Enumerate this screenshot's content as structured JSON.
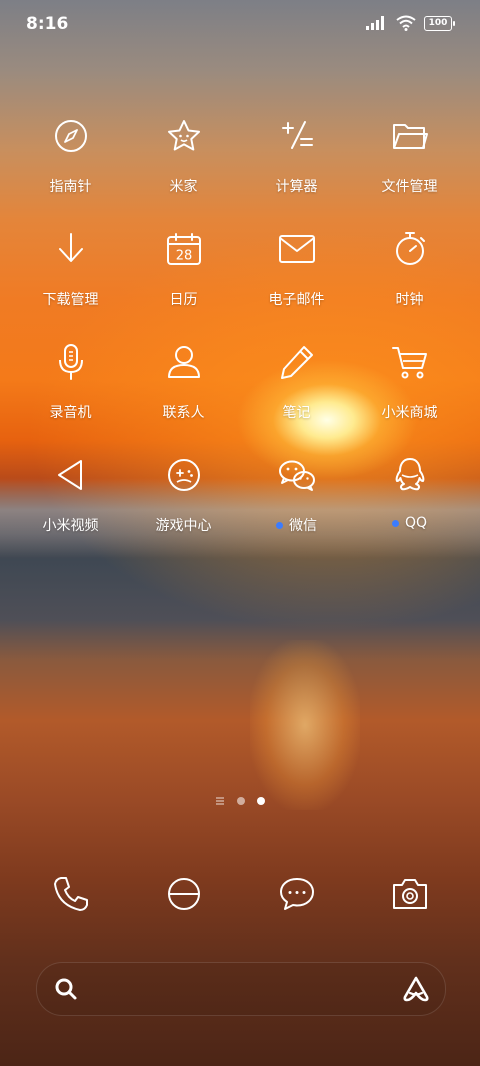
{
  "status": {
    "time": "8:16",
    "battery": "100"
  },
  "apps": [
    {
      "label": "指南针",
      "icon": "compass-icon"
    },
    {
      "label": "米家",
      "icon": "star-icon"
    },
    {
      "label": "计算器",
      "icon": "calculator-icon"
    },
    {
      "label": "文件管理",
      "icon": "folder-icon"
    },
    {
      "label": "下载管理",
      "icon": "download-icon"
    },
    {
      "label": "日历",
      "icon": "calendar-icon",
      "date": "28"
    },
    {
      "label": "电子邮件",
      "icon": "mail-icon"
    },
    {
      "label": "时钟",
      "icon": "clock-icon"
    },
    {
      "label": "录音机",
      "icon": "microphone-icon"
    },
    {
      "label": "联系人",
      "icon": "contact-icon"
    },
    {
      "label": "笔记",
      "icon": "pencil-icon"
    },
    {
      "label": "小米商城",
      "icon": "cart-icon"
    },
    {
      "label": "小米视频",
      "icon": "play-icon"
    },
    {
      "label": "游戏中心",
      "icon": "gamepad-icon"
    },
    {
      "label": "微信",
      "icon": "wechat-icon",
      "badge_color": "#3b7cff"
    },
    {
      "label": "QQ",
      "icon": "qq-icon",
      "badge_color": "#3b7cff"
    }
  ],
  "pager": {
    "total": 3,
    "active": 3
  },
  "dock": [
    {
      "icon": "phone-icon"
    },
    {
      "icon": "browser-icon"
    },
    {
      "icon": "message-icon"
    },
    {
      "icon": "camera-icon"
    }
  ],
  "search": {
    "left_icon": "search-icon",
    "right_icon": "assistant-icon"
  }
}
